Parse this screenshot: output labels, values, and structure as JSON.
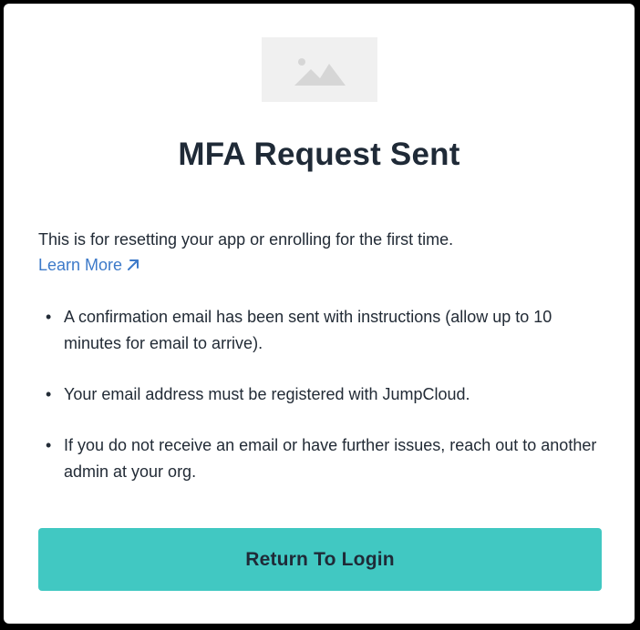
{
  "header": {
    "logo_icon": "image-placeholder-icon",
    "title": "MFA Request Sent"
  },
  "intro": {
    "text": "This is for resetting your app or enrolling for the first time.",
    "learn_more_label": "Learn More",
    "learn_more_icon": "external-link-arrow-icon"
  },
  "bullets": [
    "A confirmation email has been sent with instructions (allow up to 10 minutes for email to arrive).",
    "Your email address must be registered with JumpCloud.",
    "If you do not receive an email or have further issues, reach out to another admin at your org."
  ],
  "bullet_glyph": "•",
  "actions": {
    "return_label": "Return To Login"
  },
  "colors": {
    "accent_button": "#41c8c2",
    "link": "#3d7ac9",
    "text": "#222b36",
    "title": "#1f2a37"
  }
}
